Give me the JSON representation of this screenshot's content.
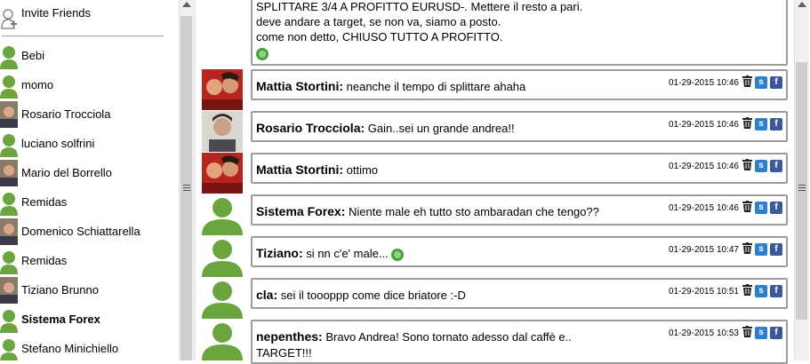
{
  "sidebar": {
    "invite_label": "Invite Friends",
    "users": [
      {
        "name": "Bebi",
        "avatar": "default",
        "bold": false
      },
      {
        "name": "momo",
        "avatar": "default",
        "bold": false
      },
      {
        "name": "Rosario Trocciola",
        "avatar": "photo",
        "bold": false
      },
      {
        "name": "luciano solfrini",
        "avatar": "default",
        "bold": false
      },
      {
        "name": "Mario del Borrello",
        "avatar": "photo",
        "bold": false
      },
      {
        "name": "Remidas",
        "avatar": "default",
        "bold": false
      },
      {
        "name": "Domenico Schiattarella",
        "avatar": "photo",
        "bold": false
      },
      {
        "name": "Remidas",
        "avatar": "default",
        "bold": false
      },
      {
        "name": "Tiziano Brunno",
        "avatar": "photo",
        "bold": false
      },
      {
        "name": "Sistema Forex",
        "avatar": "default",
        "bold": true
      },
      {
        "name": "Stefano Minichiello",
        "avatar": "default",
        "bold": false
      }
    ]
  },
  "chat": {
    "first_message": {
      "lines": [
        "SPLITTARE 3/4 A PROFITTO EURUSD-. Mettere il resto a pari.",
        "deve andare a target, se non va, siamo a posto.",
        "come non detto, CHIUSO TUTTO A PROFITTO."
      ]
    },
    "messages": [
      {
        "sender": "Mattia Stortini:",
        "text": "neanche il tempo di splittare ahaha",
        "time": "01-29-2015 10:46",
        "avatar": "photo-couple",
        "smiley": false
      },
      {
        "sender": "Rosario Trocciola:",
        "text": "Gain..sei un grande andrea!!",
        "time": "01-29-2015 10:46",
        "avatar": "photo-man",
        "smiley": false
      },
      {
        "sender": "Mattia Stortini:",
        "text": "ottimo",
        "time": "01-29-2015 10:46",
        "avatar": "photo-couple",
        "smiley": false
      },
      {
        "sender": "Sistema Forex:",
        "text": "Niente male eh tutto sto ambaradan che tengo??",
        "time": "01-29-2015 10:46",
        "avatar": "default",
        "smiley": false
      },
      {
        "sender": "Tiziano:",
        "text": "si nn c'e' male...",
        "time": "01-29-2015 10:47",
        "avatar": "default",
        "smiley": true
      },
      {
        "sender": "cla:",
        "text": "sei il toooppp come dice briatore :-D",
        "time": "01-29-2015 10:51",
        "avatar": "default",
        "smiley": false
      },
      {
        "sender": "nepenthes:",
        "text": "Bravo Andrea! Sono tornato adesso dal caffè e..",
        "text2": "TARGET!!!",
        "time": "01-29-2015 10:53",
        "avatar": "default",
        "smiley": false
      }
    ],
    "social_labels": {
      "s": "s",
      "f": "f"
    }
  },
  "colors": {
    "avatar_green": "#6aa53d",
    "facebook": "#3b5998",
    "share_blue": "#2d7fd0",
    "border": "#9c9c9c"
  }
}
